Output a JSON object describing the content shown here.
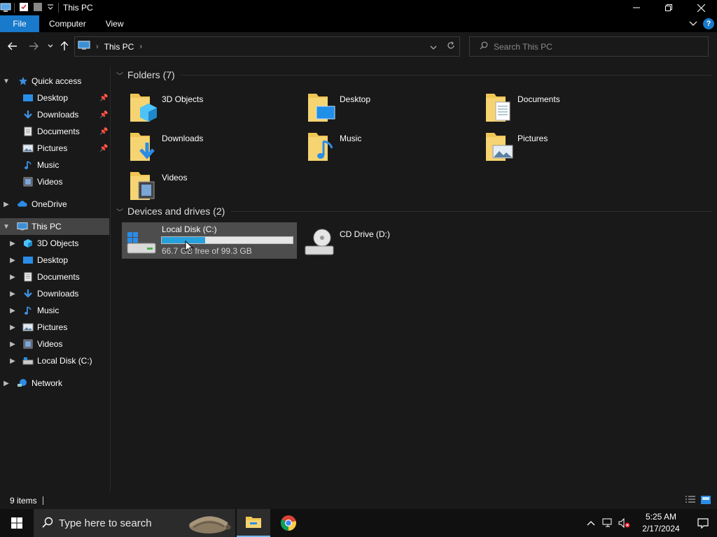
{
  "window": {
    "title": "This PC"
  },
  "ribbon": {
    "tabs": [
      {
        "label": "File"
      },
      {
        "label": "Computer"
      },
      {
        "label": "View"
      }
    ],
    "help_label": "?"
  },
  "address": {
    "crumbs": [
      "This PC"
    ]
  },
  "search": {
    "placeholder": "Search This PC"
  },
  "nav": {
    "items": [
      {
        "label": "Quick access",
        "icon": "star-icon"
      },
      {
        "label": "Desktop",
        "icon": "desktop-icon",
        "pinned": true
      },
      {
        "label": "Downloads",
        "icon": "download-icon",
        "pinned": true
      },
      {
        "label": "Documents",
        "icon": "document-icon",
        "pinned": true
      },
      {
        "label": "Pictures",
        "icon": "pictures-icon",
        "pinned": true
      },
      {
        "label": "Music",
        "icon": "music-icon"
      },
      {
        "label": "Videos",
        "icon": "videos-icon"
      },
      {
        "label": "OneDrive",
        "icon": "cloud-icon"
      },
      {
        "label": "This PC",
        "icon": "computer-icon",
        "selected": true
      },
      {
        "label": "3D Objects",
        "icon": "3d-objects-icon"
      },
      {
        "label": "Desktop",
        "icon": "desktop-icon"
      },
      {
        "label": "Documents",
        "icon": "document-icon"
      },
      {
        "label": "Downloads",
        "icon": "download-icon"
      },
      {
        "label": "Music",
        "icon": "music-icon"
      },
      {
        "label": "Pictures",
        "icon": "pictures-icon"
      },
      {
        "label": "Videos",
        "icon": "videos-icon"
      },
      {
        "label": "Local Disk (C:)",
        "icon": "drive-icon"
      },
      {
        "label": "Network",
        "icon": "network-icon"
      }
    ]
  },
  "content": {
    "folders_header": "Folders (7)",
    "folders": [
      {
        "label": "3D Objects",
        "icon": "3d-objects-folder-icon"
      },
      {
        "label": "Desktop",
        "icon": "desktop-folder-icon"
      },
      {
        "label": "Documents",
        "icon": "documents-folder-icon"
      },
      {
        "label": "Downloads",
        "icon": "downloads-folder-icon"
      },
      {
        "label": "Music",
        "icon": "music-folder-icon"
      },
      {
        "label": "Pictures",
        "icon": "pictures-folder-icon"
      },
      {
        "label": "Videos",
        "icon": "videos-folder-icon"
      }
    ],
    "drives_header": "Devices and drives (2)",
    "drives": [
      {
        "label": "Local Disk (C:)",
        "sub": "66.7 GB free of 99.3 GB",
        "used_fraction": 0.33,
        "icon": "windows-drive-icon",
        "selected": true
      },
      {
        "label": "CD Drive (D:)",
        "icon": "cd-drive-icon"
      }
    ]
  },
  "status": {
    "count": "9 items"
  },
  "taskbar": {
    "search_placeholder": "Type here to search",
    "time": "5:25 AM",
    "date": "2/17/2024"
  },
  "colors": {
    "accent": "#1979ca",
    "drive_bar": "#26a0da",
    "folder": "#f0c654"
  }
}
